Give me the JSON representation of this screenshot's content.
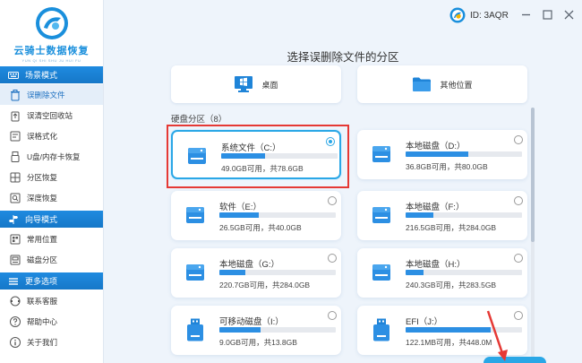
{
  "app": {
    "name": "云骑士数据恢复",
    "subtitle": "YUN QI SHI SHU JU HUI FU",
    "user_id": "ID: 3AQR",
    "accent": "#1a8fdc"
  },
  "sidebar": {
    "sections": [
      {
        "title": "场景模式",
        "icon": "keyboard-icon",
        "items": [
          {
            "label": "误删除文件",
            "icon": "trash-icon",
            "active": true
          },
          {
            "label": "误清空回收站",
            "icon": "recycle-icon"
          },
          {
            "label": "误格式化",
            "icon": "format-icon"
          },
          {
            "label": "U盘/内存卡恢复",
            "icon": "usb-icon"
          },
          {
            "label": "分区恢复",
            "icon": "partition-icon"
          },
          {
            "label": "深度恢复",
            "icon": "deep-scan-icon"
          }
        ]
      },
      {
        "title": "向导模式",
        "icon": "guide-icon",
        "items": [
          {
            "label": "常用位置",
            "icon": "location-icon"
          },
          {
            "label": "磁盘分区",
            "icon": "disk-partition-icon"
          }
        ]
      },
      {
        "title": "更多选项",
        "icon": "menu-icon",
        "items": [
          {
            "label": "联系客服",
            "icon": "support-icon"
          },
          {
            "label": "帮助中心",
            "icon": "help-icon"
          },
          {
            "label": "关于我们",
            "icon": "about-icon"
          }
        ]
      }
    ]
  },
  "window": {
    "controls": [
      "minimize-icon",
      "maximize-icon",
      "close-icon"
    ]
  },
  "main": {
    "title": "选择误删除文件的分区",
    "locations": [
      {
        "label": "桌面",
        "icon": "desktop-icon"
      },
      {
        "label": "其他位置",
        "icon": "folder-icon"
      }
    ],
    "partition_label": "硬盘分区（8）",
    "partitions": [
      {
        "name": "系统文件（C:）",
        "info": "49.0GB可用，共78.6GB",
        "usage": 0.38,
        "selected": true,
        "icon": "hard-drive-icon"
      },
      {
        "name": "本地磁盘（D:）",
        "info": "36.8GB可用，共80.0GB",
        "usage": 0.54,
        "selected": false,
        "icon": "hard-drive-icon"
      },
      {
        "name": "软件（E:）",
        "info": "26.5GB可用，共40.0GB",
        "usage": 0.34,
        "selected": false,
        "icon": "hard-drive-icon"
      },
      {
        "name": "本地磁盘（F:）",
        "info": "216.5GB可用，共284.0GB",
        "usage": 0.24,
        "selected": false,
        "icon": "hard-drive-icon"
      },
      {
        "name": "本地磁盘（G:）",
        "info": "220.7GB可用，共284.0GB",
        "usage": 0.22,
        "selected": false,
        "icon": "hard-drive-icon"
      },
      {
        "name": "本地磁盘（H:）",
        "info": "240.3GB可用，共283.5GB",
        "usage": 0.15,
        "selected": false,
        "icon": "hard-drive-icon"
      },
      {
        "name": "可移动磁盘（I:）",
        "info": "9.0GB可用，共13.8GB",
        "usage": 0.35,
        "selected": false,
        "icon": "usb-drive-icon"
      },
      {
        "name": "EFI（J:）",
        "info": "122.1MB可用，共448.0M",
        "usage": 0.73,
        "selected": false,
        "icon": "usb-drive-icon"
      }
    ]
  }
}
